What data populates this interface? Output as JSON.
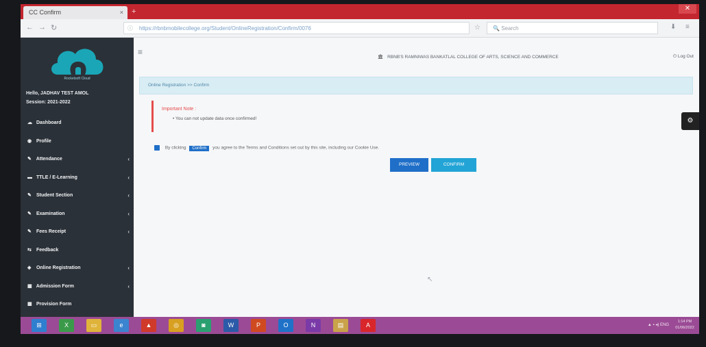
{
  "browser": {
    "tab_title": "CC Confirm",
    "tab_close": "×",
    "new_tab": "+",
    "window_close": "✕",
    "url": "https://rbnbmobilecollege.org/Student/OnlineRegistration/Confirm/0076",
    "search_placeholder": "Search",
    "search_icon": "🔍",
    "back": "←",
    "forward": "→",
    "reload": "↻",
    "bookmark_star": "☆",
    "download_icon": "⬇",
    "menu_icon": "≡"
  },
  "sidebar": {
    "brand_name": "Rocketsoft Cloud",
    "user_name": "Hello, JADHAV TEST AMOL",
    "session": "Session: 2021-2022",
    "items": [
      {
        "label": "Dashboard",
        "icon": "☁",
        "has_caret": false
      },
      {
        "label": "Profile",
        "icon": "◉",
        "has_caret": false
      },
      {
        "label": "Attendance",
        "icon": "✎",
        "has_caret": true
      },
      {
        "label": "TTLE / E-Learning",
        "icon": "▬",
        "has_caret": true
      },
      {
        "label": "Student Section",
        "icon": "✎",
        "has_caret": true
      },
      {
        "label": "Examination",
        "icon": "✎",
        "has_caret": true
      },
      {
        "label": "Fees Receipt",
        "icon": "✎",
        "has_caret": true
      },
      {
        "label": "Feedback",
        "icon": "⇆",
        "has_caret": false
      },
      {
        "label": "Online Registration",
        "icon": "◈",
        "has_caret": true
      },
      {
        "label": "Admission Form",
        "icon": "▦",
        "has_caret": true
      },
      {
        "label": "Provision Form",
        "icon": "▦",
        "has_caret": false
      }
    ],
    "caret": "‹"
  },
  "header": {
    "menu_toggle": "≡",
    "college_name": "RBNB'S RAMNIWAS BANKATLAL COLLEGE OF ARTS, SCIENCE AND COMMERCE",
    "college_icon": "🏛",
    "logout_label": "Log Out",
    "logout_icon": "⏻"
  },
  "main": {
    "breadcrumb": "Online Registration >> Confirm",
    "note_title": "Important Note :",
    "note_text": "• You can not update data once confirmed!",
    "terms_prefix": "By clicking",
    "terms_button_word": "Confirm",
    "terms_suffix": "you agree to the Terms and Conditions set out by this site, including our Cookie Use.",
    "preview_button": "PREVIEW",
    "confirm_button": "CONFIRM",
    "settings_icon": "⚙",
    "cursor": "↖"
  },
  "taskbar": {
    "apps": [
      {
        "name": "windows",
        "color": "#2f7fd0",
        "glyph": "⊞"
      },
      {
        "name": "excel",
        "color": "#3a9a4a",
        "glyph": "X"
      },
      {
        "name": "explorer",
        "color": "#e0b43a",
        "glyph": "▭"
      },
      {
        "name": "ie",
        "color": "#3a84d0",
        "glyph": "e"
      },
      {
        "name": "acrobat-reader",
        "color": "#d03a2a",
        "glyph": "▲"
      },
      {
        "name": "chrome",
        "color": "#d8a020",
        "glyph": "◎"
      },
      {
        "name": "camera",
        "color": "#2aa070",
        "glyph": "◙"
      },
      {
        "name": "word",
        "color": "#2b5aa8",
        "glyph": "W"
      },
      {
        "name": "powerpoint",
        "color": "#d04a20",
        "glyph": "P"
      },
      {
        "name": "outlook",
        "color": "#1f72c8",
        "glyph": "O"
      },
      {
        "name": "onenote",
        "color": "#7a3aa8",
        "glyph": "N"
      },
      {
        "name": "folder",
        "color": "#c9a24a",
        "glyph": "▤"
      },
      {
        "name": "adobe",
        "color": "#d8262a",
        "glyph": "A"
      }
    ],
    "tray_text": "▲ ▪ ◂) ENG",
    "clock_time": "1:14 PM",
    "clock_date": "01/06/2022"
  },
  "colors": {
    "sidebar_bg": "#2b3138",
    "accent_blue": "#1f6fc8",
    "confirm_blue": "#22a4d6",
    "note_red": "#e54b4b",
    "taskbar": "#9b4b95",
    "titlebar": "#c3262f"
  }
}
